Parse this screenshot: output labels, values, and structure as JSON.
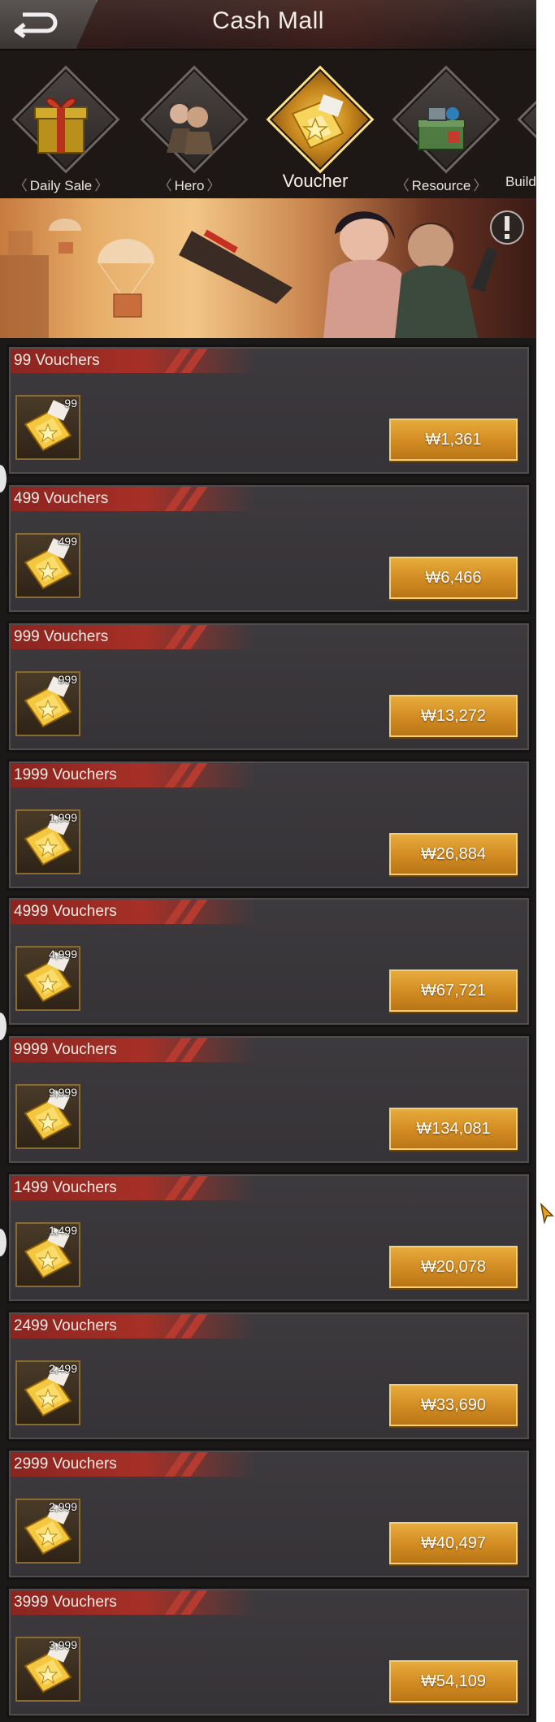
{
  "header": {
    "title": "Cash Mall"
  },
  "tabs": [
    {
      "label": "Daily Sale",
      "icon": "gift-box-icon"
    },
    {
      "label": "Hero",
      "icon": "hero-portrait-icon"
    },
    {
      "label": "Voucher",
      "icon": "voucher-ticket-icon",
      "active": true
    },
    {
      "label": "Resource",
      "icon": "resource-crate-icon"
    },
    {
      "label": "Build &",
      "icon": "potion-flask-icon"
    }
  ],
  "vouchers": [
    {
      "title": "99 Vouchers",
      "count": "99",
      "price": "₩1,361"
    },
    {
      "title": "499 Vouchers",
      "count": "499",
      "price": "₩6,466"
    },
    {
      "title": "999 Vouchers",
      "count": "999",
      "price": "₩13,272"
    },
    {
      "title": "1999 Vouchers",
      "count": "1,999",
      "price": "₩26,884"
    },
    {
      "title": "4999 Vouchers",
      "count": "4,999",
      "price": "₩67,721"
    },
    {
      "title": "9999 Vouchers",
      "count": "9,999",
      "price": "₩134,081"
    },
    {
      "title": "1499 Vouchers",
      "count": "1,499",
      "price": "₩20,078"
    },
    {
      "title": "2499 Vouchers",
      "count": "2,499",
      "price": "₩33,690"
    },
    {
      "title": "2999 Vouchers",
      "count": "2,999",
      "price": "₩40,497"
    },
    {
      "title": "3999 Vouchers",
      "count": "3,999",
      "price": "₩54,109"
    }
  ],
  "colors": {
    "accent_gold": "#d9952a",
    "title_red": "#a73027",
    "panel": "#3a373b"
  }
}
